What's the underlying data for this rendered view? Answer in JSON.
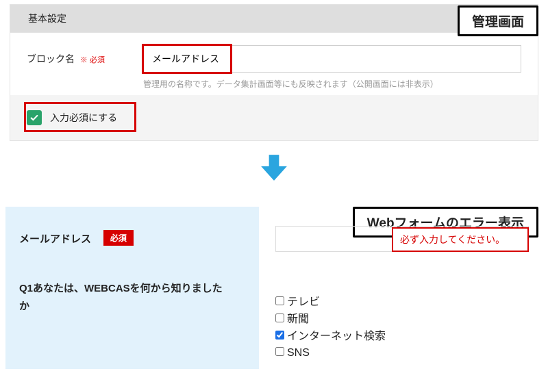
{
  "admin": {
    "section_title": "基本設定",
    "block_name_label": "ブロック名",
    "required_mark": "※ 必須",
    "block_name_value": "メールアドレス",
    "hint": "管理用の名称です。データ集計画面等にも反映されます（公開画面には非表示）",
    "require_checkbox_label": "入力必須にする"
  },
  "float_labels": {
    "admin": "管理画面",
    "form": "Webフォームのエラー表示"
  },
  "form": {
    "email_label": "メールアドレス",
    "required_badge": "必須",
    "error_message": "必ず入力してください。",
    "q1_text": "Q1あなたは、WEBCASを何から知りましたか",
    "options": [
      {
        "label": "テレビ",
        "checked": false
      },
      {
        "label": "新聞",
        "checked": false
      },
      {
        "label": "インターネット検索",
        "checked": true
      },
      {
        "label": "SNS",
        "checked": false
      }
    ]
  }
}
